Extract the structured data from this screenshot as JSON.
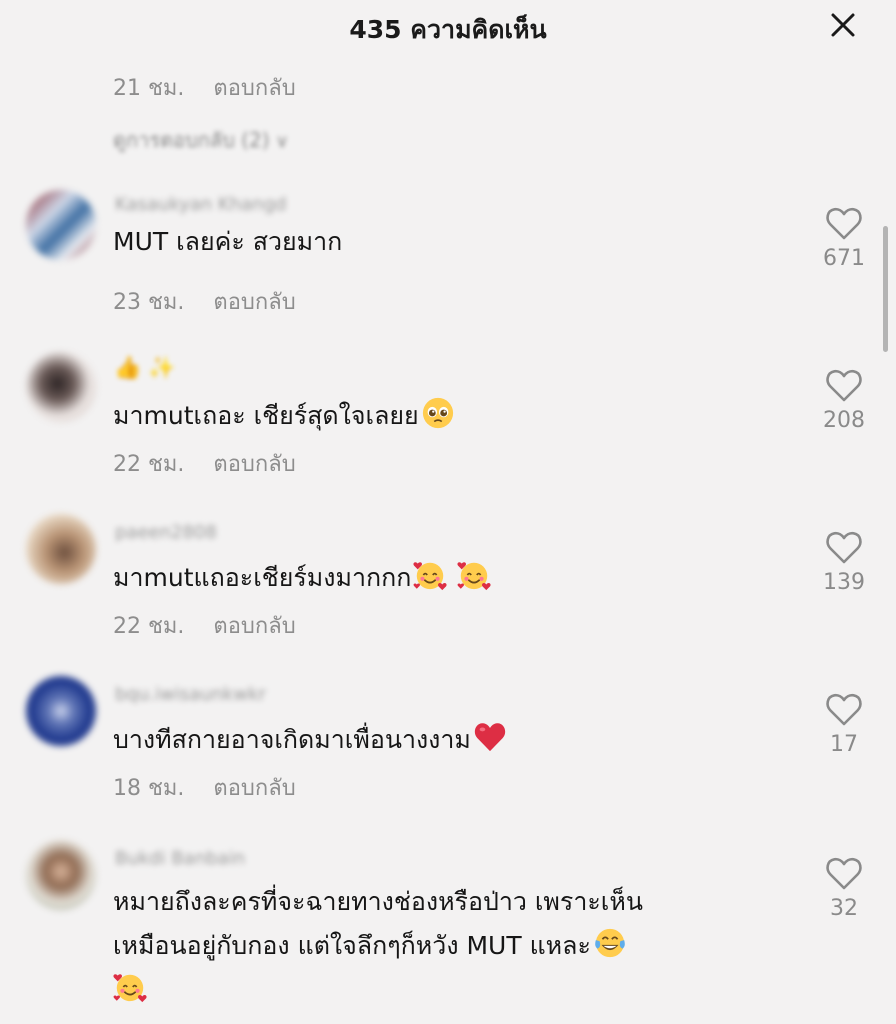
{
  "header": {
    "title": "435 ความคิดเห็น",
    "close_icon": "close-icon"
  },
  "previous_comment": {
    "time": "21 ชม.",
    "reply_label": "ตอบกลับ",
    "view_replies_label": "ดูการตอบกลับ (2)",
    "chevron_icon": "chevron-down-icon"
  },
  "comments": [
    {
      "username": "Kasaukyan Khangd",
      "text": "MUT เลยค่ะ สวยมาก",
      "time": "23 ชม.",
      "reply_label": "ตอบกลับ",
      "likes": "671",
      "emojis": []
    },
    {
      "username": "",
      "text": "มาmutเถอะ เชียร์สุดใจเลยย",
      "time": "22 ชม.",
      "reply_label": "ตอบกลับ",
      "likes": "208",
      "emojis": [
        "pleading-face"
      ]
    },
    {
      "username": "paeen2808",
      "text": "มาmutแถอะเชียร์มงมากกก",
      "time": "22 ชม.",
      "reply_label": "ตอบกลับ",
      "likes": "139",
      "emojis": [
        "smiling-face-with-hearts",
        "smiling-face-with-hearts"
      ]
    },
    {
      "username": "bqu.iwisaunkwkr",
      "text": "บางทีสกายอาจเกิดมาเพื่อนางงาม",
      "time": "18 ชม.",
      "reply_label": "ตอบกลับ",
      "likes": "17",
      "emojis": [
        "red-heart"
      ]
    },
    {
      "username": "Bukdi Banbain",
      "text_lines": [
        "หมายถึงละครที่จะฉายทางช่องหรือป่าว เพราะเห็น",
        "เหมือนอยู่กับกอง แต่ใจลึกๆก็หวัง MUT แหละ"
      ],
      "likes": "32",
      "emojis": [
        "face-with-tears-of-joy",
        "smiling-face-with-hearts"
      ]
    }
  ],
  "colors": {
    "background": "#f3f2f2",
    "text": "#161616",
    "meta": "#8d8d8d",
    "heart_outline": "#8a8a8a"
  }
}
